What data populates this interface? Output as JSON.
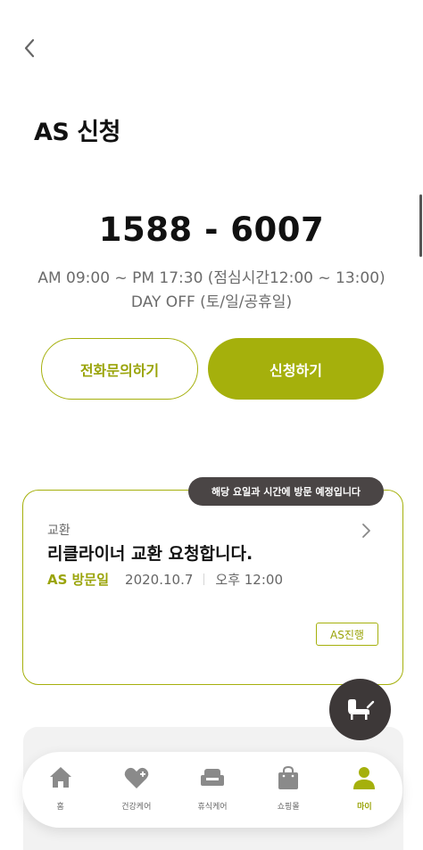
{
  "header": {
    "back_icon": "chevron-left-icon",
    "title": "AS 신청"
  },
  "contact": {
    "phone": "1588 - 6007",
    "hours": "AM 09:00 ~ PM 17:30 (점심시간12:00 ~ 13:00)",
    "day_off": "DAY OFF (토/일/공휴일)"
  },
  "actions": {
    "call_label": "전화문의하기",
    "apply_label": "신청하기"
  },
  "request_card": {
    "notice": "해당 요일과 시간에 방문 예정입니다",
    "category": "교환",
    "title": "리클라이너 교환 요청합니다.",
    "visit_label": "AS 방문일",
    "visit_date": "2020.10.7",
    "visit_time": "오후 12:00",
    "status_badge": "AS진행"
  },
  "fab": {
    "icon": "recliner-icon"
  },
  "tabbar": {
    "items": [
      {
        "label": "홈",
        "icon": "home-icon"
      },
      {
        "label": "건강케어",
        "icon": "heart-plus-icon"
      },
      {
        "label": "휴식케어",
        "icon": "sofa-icon"
      },
      {
        "label": "쇼핑몰",
        "icon": "shopping-bag-icon"
      },
      {
        "label": "마이",
        "icon": "user-icon"
      }
    ],
    "active_index": 4
  },
  "colors": {
    "accent": "#a5b00c",
    "dark": "#3d3838",
    "inactive_icon": "#8a8a8a"
  }
}
